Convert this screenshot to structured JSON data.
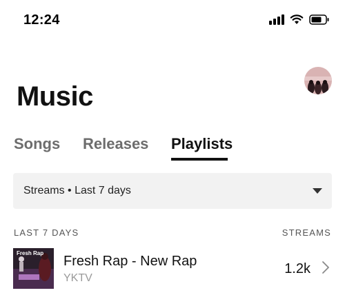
{
  "status_bar": {
    "time": "12:24",
    "icons": [
      "signal-icon",
      "wifi-icon",
      "battery-icon"
    ]
  },
  "header": {
    "title": "Music",
    "avatar": "profile-avatar"
  },
  "tabs": [
    {
      "label": "Songs",
      "active": false
    },
    {
      "label": "Releases",
      "active": false
    },
    {
      "label": "Playlists",
      "active": true
    }
  ],
  "filter": {
    "label": "Streams • Last 7 days",
    "icon": "caret-down-icon"
  },
  "list": {
    "header_left": "LAST 7 DAYS",
    "header_right": "STREAMS",
    "rows": [
      {
        "thumb_text": "Fresh Rap",
        "title": "Fresh Rap - New Rap",
        "subtitle": "YKTV",
        "streams": "1.2k",
        "icon": "chevron-right-icon"
      }
    ]
  },
  "colors": {
    "text_primary": "#111111",
    "text_secondary": "#6d6d6d",
    "filter_bg": "#f2f2f2",
    "accent_underline": "#111111"
  }
}
